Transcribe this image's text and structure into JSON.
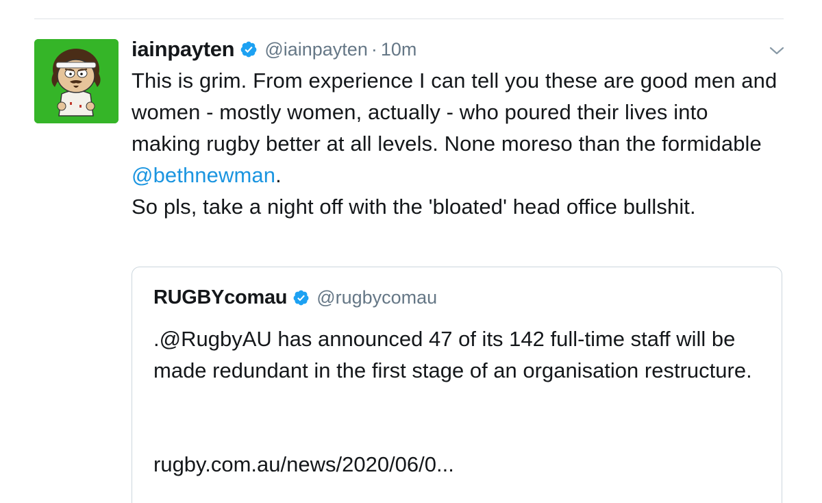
{
  "tweet": {
    "display_name": "iainpayten",
    "handle": "@iainpayten",
    "separator": "·",
    "time": "10m",
    "text_part1": "This is grim. From experience I can tell you these are good men and women - mostly women, actually - who poured their lives into making rugby better at all levels. None moreso than the formidable ",
    "mention": "@bethnewman",
    "text_part2": ".\nSo pls, take a night off with the 'bloated' head office bullshit."
  },
  "quoted_tweet": {
    "display_name": "RUGBYcomau",
    "handle": "@rugbycomau",
    "text": ".@RugbyAU has announced 47 of its 142 full-time staff will be made redundant in the first stage of an organisation restructure.",
    "link": "rugby.com.au/news/2020/06/0..."
  },
  "icons": {
    "verified": "verified-badge-icon",
    "more": "chevron-down-icon"
  },
  "colors": {
    "link": "#1b95e0",
    "secondary_text": "#657786",
    "border": "#ccd6dd",
    "avatar_bg": "#35b528",
    "verified": "#1da1f2"
  }
}
